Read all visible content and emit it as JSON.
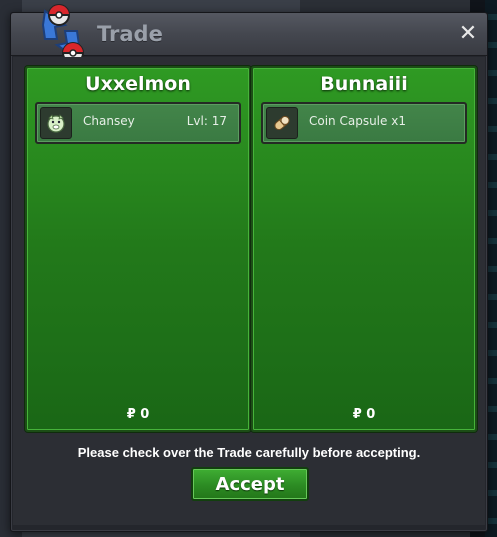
{
  "window": {
    "title": "Trade",
    "close_label": "✕"
  },
  "left_panel": {
    "player": "Uxxelmon",
    "item": {
      "name": "Chansey",
      "level": "Lvl: 17",
      "icon": "chansey-icon"
    },
    "money": "₽ 0"
  },
  "right_panel": {
    "player": "Bunnaiii",
    "item": {
      "name": "Coin Capsule  x1",
      "icon": "coin-capsule-icon"
    },
    "money": "₽ 0"
  },
  "notice": "Please check over the Trade carefully before accepting.",
  "accept_label": "Accept",
  "colors": {
    "panel_green": "#2f9a23",
    "accept_green": "#2c8b23",
    "title_gray": "#9aa0aa"
  }
}
